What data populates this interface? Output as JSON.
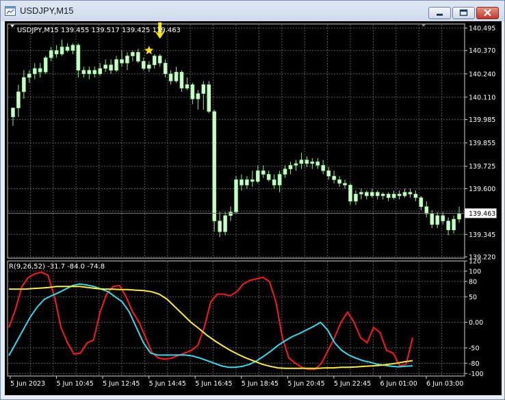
{
  "window": {
    "title": "USDJPY,M15",
    "buttons": {
      "minimize": "minimize-icon",
      "maximize": "maximize-icon",
      "close": "close-icon"
    }
  },
  "colors": {
    "background": "#000000",
    "grid": "#5c5c5c",
    "text": "#ffffff",
    "bull_candle": "#c8ffc8",
    "wick": "#90ee90",
    "price_line": "#7f7f7f",
    "marker": "#ffea00",
    "rsi_fast": "#ff1a1a",
    "rsi_mid": "#33ddee",
    "rsi_slow": "#ffee33"
  },
  "chart_data": {
    "type": "candlestick",
    "symbol": "USDJPY,M15",
    "ohlc_header": "139.455 139.517 139.425 139.463",
    "price_axis": {
      "ylim": [
        139.22,
        140.495
      ],
      "tick_labels": [
        "140.495",
        "140.370",
        "140.240",
        "140.110",
        "139.985",
        "139.855",
        "139.725",
        "139.600",
        "139.475",
        "139.345",
        "139.220"
      ]
    },
    "current_price": {
      "label": "139.463",
      "value": 139.463
    },
    "candles": [
      {
        "o": 140.0,
        "h": 140.05,
        "l": 139.95,
        "c": 140.05
      },
      {
        "o": 140.05,
        "h": 140.18,
        "l": 140.0,
        "c": 140.14
      },
      {
        "o": 140.14,
        "h": 140.26,
        "l": 140.1,
        "c": 140.22
      },
      {
        "o": 140.22,
        "h": 140.26,
        "l": 140.19,
        "c": 140.24
      },
      {
        "o": 140.24,
        "h": 140.3,
        "l": 140.21,
        "c": 140.27
      },
      {
        "o": 140.27,
        "h": 140.3,
        "l": 140.22,
        "c": 140.25
      },
      {
        "o": 140.25,
        "h": 140.34,
        "l": 140.24,
        "c": 140.33
      },
      {
        "o": 140.33,
        "h": 140.39,
        "l": 140.31,
        "c": 140.37
      },
      {
        "o": 140.37,
        "h": 140.4,
        "l": 140.33,
        "c": 140.35
      },
      {
        "o": 140.35,
        "h": 140.43,
        "l": 140.34,
        "c": 140.39
      },
      {
        "o": 140.39,
        "h": 140.41,
        "l": 140.36,
        "c": 140.37
      },
      {
        "o": 140.37,
        "h": 140.41,
        "l": 140.35,
        "c": 140.4
      },
      {
        "o": 140.4,
        "h": 140.41,
        "l": 140.22,
        "c": 140.26
      },
      {
        "o": 140.26,
        "h": 140.28,
        "l": 140.22,
        "c": 140.24
      },
      {
        "o": 140.24,
        "h": 140.28,
        "l": 140.21,
        "c": 140.26
      },
      {
        "o": 140.26,
        "h": 140.28,
        "l": 140.22,
        "c": 140.24
      },
      {
        "o": 140.24,
        "h": 140.3,
        "l": 140.23,
        "c": 140.27
      },
      {
        "o": 140.27,
        "h": 140.32,
        "l": 140.25,
        "c": 140.29
      },
      {
        "o": 140.29,
        "h": 140.32,
        "l": 140.24,
        "c": 140.26
      },
      {
        "o": 140.26,
        "h": 140.34,
        "l": 140.25,
        "c": 140.32
      },
      {
        "o": 140.32,
        "h": 140.37,
        "l": 140.28,
        "c": 140.3
      },
      {
        "o": 140.3,
        "h": 140.36,
        "l": 140.26,
        "c": 140.34
      },
      {
        "o": 140.34,
        "h": 140.37,
        "l": 140.31,
        "c": 140.36
      },
      {
        "o": 140.36,
        "h": 140.38,
        "l": 140.3,
        "c": 140.31
      },
      {
        "o": 140.31,
        "h": 140.33,
        "l": 140.26,
        "c": 140.27
      },
      {
        "o": 140.27,
        "h": 140.31,
        "l": 140.25,
        "c": 140.29
      },
      {
        "o": 140.29,
        "h": 140.35,
        "l": 140.27,
        "c": 140.34
      },
      {
        "o": 140.34,
        "h": 140.35,
        "l": 140.28,
        "c": 140.3
      },
      {
        "o": 140.3,
        "h": 140.32,
        "l": 140.22,
        "c": 140.24
      },
      {
        "o": 140.24,
        "h": 140.26,
        "l": 140.18,
        "c": 140.2
      },
      {
        "o": 140.2,
        "h": 140.28,
        "l": 140.19,
        "c": 140.25
      },
      {
        "o": 140.25,
        "h": 140.26,
        "l": 140.14,
        "c": 140.16
      },
      {
        "o": 140.16,
        "h": 140.22,
        "l": 140.15,
        "c": 140.18
      },
      {
        "o": 140.18,
        "h": 140.19,
        "l": 140.07,
        "c": 140.1
      },
      {
        "o": 140.1,
        "h": 140.15,
        "l": 140.04,
        "c": 140.13
      },
      {
        "o": 140.13,
        "h": 140.2,
        "l": 140.04,
        "c": 140.18
      },
      {
        "o": 140.18,
        "h": 140.2,
        "l": 140.02,
        "c": 140.03
      },
      {
        "o": 140.03,
        "h": 140.04,
        "l": 139.36,
        "c": 139.42
      },
      {
        "o": 139.42,
        "h": 139.47,
        "l": 139.33,
        "c": 139.36
      },
      {
        "o": 139.36,
        "h": 139.47,
        "l": 139.34,
        "c": 139.45
      },
      {
        "o": 139.45,
        "h": 139.5,
        "l": 139.42,
        "c": 139.47
      },
      {
        "o": 139.47,
        "h": 139.67,
        "l": 139.46,
        "c": 139.65
      },
      {
        "o": 139.65,
        "h": 139.68,
        "l": 139.59,
        "c": 139.62
      },
      {
        "o": 139.62,
        "h": 139.67,
        "l": 139.6,
        "c": 139.65
      },
      {
        "o": 139.65,
        "h": 139.7,
        "l": 139.61,
        "c": 139.64
      },
      {
        "o": 139.64,
        "h": 139.73,
        "l": 139.63,
        "c": 139.7
      },
      {
        "o": 139.7,
        "h": 139.73,
        "l": 139.66,
        "c": 139.68
      },
      {
        "o": 139.68,
        "h": 139.7,
        "l": 139.64,
        "c": 139.65
      },
      {
        "o": 139.65,
        "h": 139.68,
        "l": 139.6,
        "c": 139.62
      },
      {
        "o": 139.62,
        "h": 139.7,
        "l": 139.58,
        "c": 139.68
      },
      {
        "o": 139.68,
        "h": 139.73,
        "l": 139.66,
        "c": 139.71
      },
      {
        "o": 139.71,
        "h": 139.75,
        "l": 139.68,
        "c": 139.73
      },
      {
        "o": 139.73,
        "h": 139.76,
        "l": 139.7,
        "c": 139.74
      },
      {
        "o": 139.74,
        "h": 139.8,
        "l": 139.71,
        "c": 139.76
      },
      {
        "o": 139.76,
        "h": 139.78,
        "l": 139.72,
        "c": 139.74
      },
      {
        "o": 139.74,
        "h": 139.77,
        "l": 139.71,
        "c": 139.75
      },
      {
        "o": 139.75,
        "h": 139.77,
        "l": 139.71,
        "c": 139.73
      },
      {
        "o": 139.73,
        "h": 139.76,
        "l": 139.68,
        "c": 139.7
      },
      {
        "o": 139.7,
        "h": 139.72,
        "l": 139.65,
        "c": 139.67
      },
      {
        "o": 139.67,
        "h": 139.7,
        "l": 139.63,
        "c": 139.65
      },
      {
        "o": 139.65,
        "h": 139.67,
        "l": 139.61,
        "c": 139.63
      },
      {
        "o": 139.63,
        "h": 139.65,
        "l": 139.6,
        "c": 139.62
      },
      {
        "o": 139.62,
        "h": 139.63,
        "l": 139.51,
        "c": 139.53
      },
      {
        "o": 139.53,
        "h": 139.59,
        "l": 139.51,
        "c": 139.57
      },
      {
        "o": 139.57,
        "h": 139.6,
        "l": 139.54,
        "c": 139.58
      },
      {
        "o": 139.58,
        "h": 139.59,
        "l": 139.54,
        "c": 139.56
      },
      {
        "o": 139.56,
        "h": 139.6,
        "l": 139.55,
        "c": 139.58
      },
      {
        "o": 139.58,
        "h": 139.59,
        "l": 139.54,
        "c": 139.56
      },
      {
        "o": 139.56,
        "h": 139.58,
        "l": 139.54,
        "c": 139.57
      },
      {
        "o": 139.57,
        "h": 139.58,
        "l": 139.53,
        "c": 139.55
      },
      {
        "o": 139.55,
        "h": 139.59,
        "l": 139.54,
        "c": 139.57
      },
      {
        "o": 139.57,
        "h": 139.59,
        "l": 139.54,
        "c": 139.56
      },
      {
        "o": 139.56,
        "h": 139.6,
        "l": 139.55,
        "c": 139.58
      },
      {
        "o": 139.58,
        "h": 139.6,
        "l": 139.55,
        "c": 139.57
      },
      {
        "o": 139.57,
        "h": 139.59,
        "l": 139.53,
        "c": 139.55
      },
      {
        "o": 139.55,
        "h": 139.56,
        "l": 139.48,
        "c": 139.5
      },
      {
        "o": 139.5,
        "h": 139.53,
        "l": 139.44,
        "c": 139.46
      },
      {
        "o": 139.46,
        "h": 139.48,
        "l": 139.38,
        "c": 139.4
      },
      {
        "o": 139.4,
        "h": 139.47,
        "l": 139.38,
        "c": 139.45
      },
      {
        "o": 139.45,
        "h": 139.47,
        "l": 139.4,
        "c": 139.42
      },
      {
        "o": 139.42,
        "h": 139.44,
        "l": 139.34,
        "c": 139.37
      },
      {
        "o": 139.37,
        "h": 139.45,
        "l": 139.35,
        "c": 139.43
      },
      {
        "o": 139.43,
        "h": 139.5,
        "l": 139.41,
        "c": 139.46
      }
    ],
    "markers": [
      {
        "type": "arrow-down",
        "bar": 27,
        "price": 140.42
      },
      {
        "type": "star",
        "bar": 25,
        "price": 140.37
      }
    ],
    "indicator": {
      "label": "R(9,26,52) -31.7 -84.0 -74.8",
      "ylim": [
        -105,
        120
      ],
      "tick_labels": [
        "120",
        "100",
        "80",
        "50",
        "0.00",
        "-50",
        "-80",
        "-100"
      ],
      "series": [
        {
          "color": "#ff1a1a",
          "values": [
            -10,
            25,
            70,
            88,
            95,
            98,
            92,
            50,
            -10,
            -40,
            -62,
            -60,
            -40,
            -35,
            20,
            55,
            70,
            72,
            50,
            20,
            0,
            -30,
            -60,
            -70,
            -72,
            -70,
            -65,
            -60,
            -55,
            -45,
            -10,
            40,
            55,
            55,
            52,
            60,
            75,
            82,
            85,
            88,
            80,
            40,
            -30,
            -70,
            -80,
            -88,
            -92,
            -92,
            -80,
            -55,
            -30,
            0,
            20,
            0,
            -30,
            -40,
            -10,
            -20,
            -55,
            -60,
            -85,
            -82,
            -30
          ]
        },
        {
          "color": "#33ddee",
          "values": [
            -65,
            -40,
            -15,
            10,
            30,
            45,
            52,
            58,
            65,
            72,
            75,
            73,
            70,
            65,
            60,
            50,
            40,
            20,
            -10,
            -40,
            -60,
            -64,
            -64,
            -64,
            -64,
            -64,
            -66,
            -70,
            -75,
            -80,
            -85,
            -88,
            -88,
            -86,
            -82,
            -75,
            -66,
            -56,
            -45,
            -36,
            -28,
            -22,
            -15,
            -8,
            0,
            -15,
            -40,
            -55,
            -64,
            -70,
            -75,
            -78,
            -82,
            -84,
            -86,
            -87,
            -86,
            -85
          ]
        },
        {
          "color": "#ffee33",
          "values": [
            65,
            65,
            65,
            66,
            67,
            68,
            70,
            70,
            70,
            70,
            68,
            66,
            65,
            65,
            64,
            64,
            63,
            62,
            60,
            55,
            45,
            30,
            15,
            0,
            -12,
            -25,
            -36,
            -46,
            -55,
            -63,
            -70,
            -76,
            -82,
            -86,
            -89,
            -90,
            -90,
            -90,
            -90,
            -90,
            -89,
            -89,
            -88,
            -88,
            -87,
            -86,
            -85,
            -84,
            -82,
            -80,
            -77,
            -75
          ]
        }
      ]
    },
    "x_tick_labels": [
      "5 Jun 2023",
      "5 Jun 10:45",
      "5 Jun 12:45",
      "5 Jun 14:45",
      "5 Jun 16:45",
      "5 Jun 18:45",
      "5 Jun 20:45",
      "5 Jun 22:45",
      "6 Jun 01:00",
      "6 Jun 03:00"
    ]
  }
}
